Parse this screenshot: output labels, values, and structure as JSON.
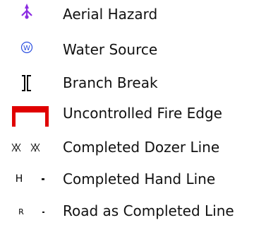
{
  "legend": {
    "items": [
      {
        "label": "Aerial Hazard",
        "icon": "aerial-hazard-icon",
        "color": "#8B2BE2"
      },
      {
        "label": "Water Source",
        "icon": "water-source-icon",
        "symbol_text": "W",
        "color": "#2B4FE0"
      },
      {
        "label": "Branch Break",
        "icon": "branch-break-icon",
        "color": "#000000"
      },
      {
        "label": "Uncontrolled Fire Edge",
        "icon": "uncontrolled-fire-edge-icon",
        "color": "#E00000"
      },
      {
        "label": "Completed Dozer Line",
        "icon": "completed-dozer-line-icon",
        "color": "#000000"
      },
      {
        "label": "Completed Hand Line",
        "icon": "completed-hand-line-icon",
        "symbol_text": "H",
        "color": "#000000"
      },
      {
        "label": "Road as Completed Line",
        "icon": "road-as-completed-line-icon",
        "symbol_text": "R",
        "color": "#000000"
      }
    ]
  }
}
